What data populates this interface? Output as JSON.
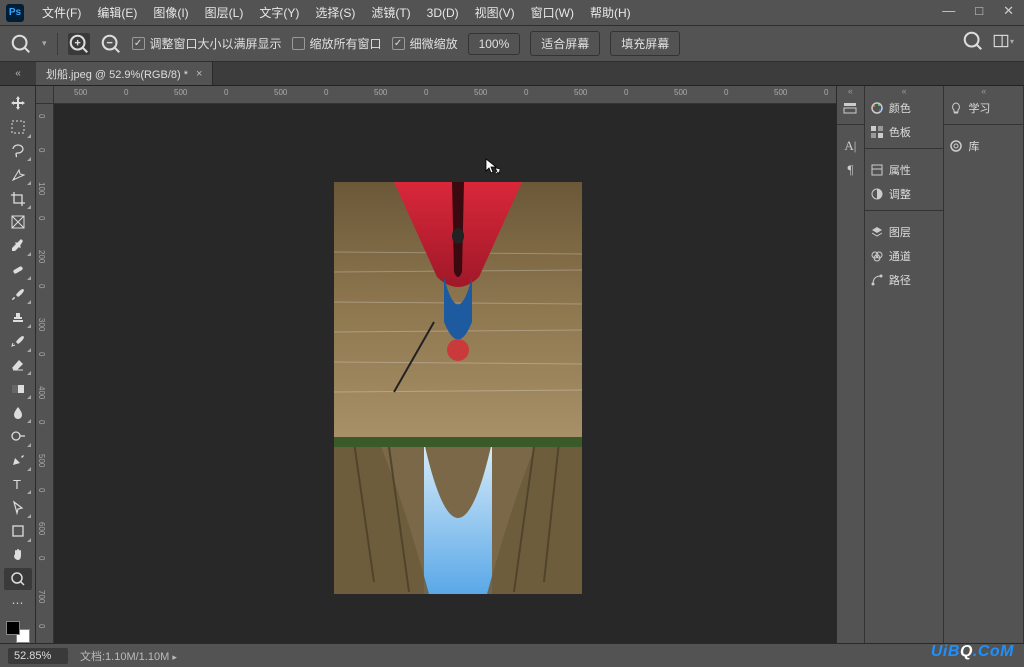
{
  "menu": {
    "file": "文件(F)",
    "edit": "编辑(E)",
    "image": "图像(I)",
    "layer": "图层(L)",
    "type": "文字(Y)",
    "select": "选择(S)",
    "filter": "滤镜(T)",
    "threeD": "3D(D)",
    "view": "视图(V)",
    "window": "窗口(W)",
    "help": "帮助(H)"
  },
  "win": {
    "min": "—",
    "max": "□",
    "close": "✕"
  },
  "options": {
    "resize_fit": "调整窗口大小以满屏显示",
    "zoom_all": "缩放所有窗口",
    "scrubby": "细微缩放",
    "pct": "100%",
    "fit": "适合屏幕",
    "fill": "填充屏幕"
  },
  "tabs": {
    "collapse": "«",
    "doc": {
      "title": "划船.jpeg @ 52.9%(RGB/8) *",
      "close": "×"
    }
  },
  "ruler_h": [
    "500",
    "0",
    "500",
    "0",
    "500",
    "0",
    "500",
    "0",
    "500",
    "0",
    "500",
    "0",
    "500",
    "0",
    "500",
    "0"
  ],
  "ruler_v": [
    "0",
    "0",
    "100",
    "0",
    "200",
    "0",
    "300",
    "0",
    "400",
    "0",
    "500",
    "0",
    "600",
    "0",
    "700",
    "0"
  ],
  "panels": {
    "col1_collapse": "«",
    "col2_collapse": "«",
    "col3_collapse": "«",
    "color": "颜色",
    "swatches": "色板",
    "properties": "属性",
    "adjust": "调整",
    "layers": "图层",
    "channels": "通道",
    "paths": "路径",
    "learn": "学习",
    "libraries": "库"
  },
  "status": {
    "zoom": "52.85%",
    "doc": "文档:1.10M/1.10M",
    "arrow": "▸"
  },
  "watermark": {
    "a": "UiB",
    "b": "Q",
    "c": ".CoM"
  }
}
